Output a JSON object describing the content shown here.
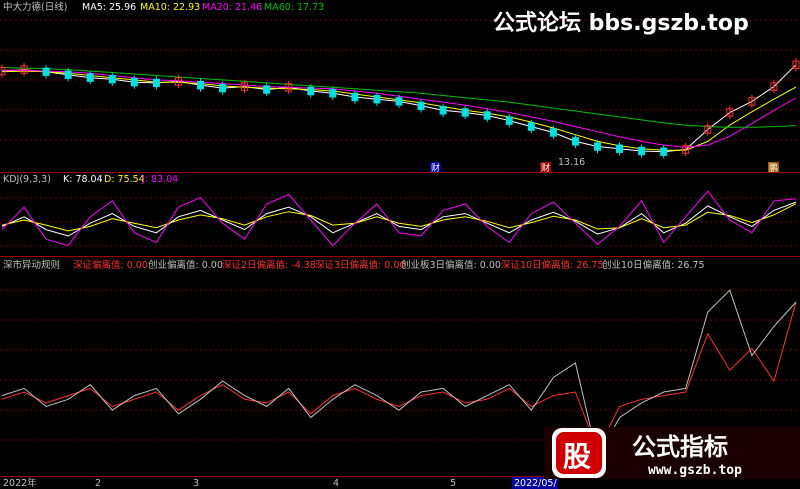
{
  "watermark_top": "公式论坛 bbs.gszb.top",
  "watermark_bottom": {
    "badge": "股",
    "title": "公式指标",
    "url": "www.gszb.top"
  },
  "panel1": {
    "stock": "中大力德(日线)",
    "ma": [
      {
        "label": "MA5: 25.96",
        "color": "#ffffff"
      },
      {
        "label": "MA10: 22.93",
        "color": "#ffff00"
      },
      {
        "label": "MA20: 21.46",
        "color": "#ff00ff"
      },
      {
        "label": "MA60: 17.73",
        "color": "#00c000"
      }
    ],
    "low_label": "13.16",
    "markers": [
      "财",
      "财",
      "鹏"
    ]
  },
  "panel2": {
    "title": "KDJ(9,3,3)",
    "k": "K: 78.04",
    "d": "D: 75.54",
    "j": "J: 83.04"
  },
  "panel3": {
    "title": "深市异动规则",
    "items": [
      {
        "label": "深证偏离值: 0.00",
        "color": "#ff3030"
      },
      {
        "label": "创业偏离值: 0.00",
        "color": "#c0c0c0"
      },
      {
        "label": "深证2日偏离值: -4.38",
        "color": "#ff3030"
      },
      {
        "label": "深证3日偏离值: 0.00",
        "color": "#ff3030"
      },
      {
        "label": "创业板3日偏离值: 0.00",
        "color": "#c0c0c0"
      },
      {
        "label": "深证10日偏离值: 26.75",
        "color": "#ff3030"
      },
      {
        "label": "创业10日偏离值: 26.75",
        "color": "#c0c0c0"
      }
    ]
  },
  "x_axis": [
    "2022年",
    "2",
    "3",
    "4",
    "5",
    "2022/05/"
  ],
  "colors": {
    "grid": "#7a0000",
    "up": "#ff3030",
    "down": "#00e0e0",
    "separator": "#a00000"
  },
  "chart_data": {
    "type": "line",
    "panels": [
      {
        "name": "price",
        "series": [
          {
            "name": "MA5",
            "values": [
              25.1,
              25.3,
              25.0,
              24.6,
              24.2,
              24.0,
              23.6,
              23.5,
              23.7,
              23.2,
              22.8,
              23.0,
              22.6,
              22.9,
              22.4,
              22.1,
              21.6,
              21.3,
              21.0,
              20.4,
              19.8,
              19.5,
              19.1,
              18.4,
              17.6,
              16.8,
              15.6,
              14.9,
              14.6,
              14.3,
              14.2,
              14.5,
              17.2,
              19.5,
              21.0,
              23.0,
              25.96
            ]
          },
          {
            "name": "MA10",
            "values": [
              25.0,
              25.1,
              25.0,
              24.8,
              24.5,
              24.2,
              23.9,
              23.6,
              23.6,
              23.4,
              23.1,
              22.9,
              22.8,
              22.7,
              22.6,
              22.4,
              22.0,
              21.6,
              21.2,
              20.8,
              20.3,
              19.8,
              19.4,
              18.9,
              18.2,
              17.4,
              16.5,
              15.6,
              15.0,
              14.6,
              14.4,
              14.4,
              15.6,
              17.8,
              19.6,
              21.3,
              22.93
            ]
          },
          {
            "name": "MA20",
            "values": [
              25.2,
              25.2,
              25.1,
              25.0,
              24.8,
              24.5,
              24.2,
              23.9,
              23.8,
              23.6,
              23.4,
              23.2,
              23.0,
              22.9,
              22.8,
              22.7,
              22.4,
              22.1,
              21.7,
              21.3,
              20.9,
              20.5,
              20.0,
              19.5,
              18.9,
              18.3,
              17.6,
              16.9,
              16.2,
              15.6,
              15.1,
              14.8,
              15.1,
              16.3,
              18.0,
              19.8,
              21.46
            ]
          },
          {
            "name": "MA60",
            "values": [
              25.6,
              25.5,
              25.4,
              25.3,
              25.1,
              24.9,
              24.7,
              24.5,
              24.3,
              24.1,
              23.9,
              23.7,
              23.5,
              23.3,
              23.1,
              22.9,
              22.7,
              22.5,
              22.3,
              22.1,
              21.8,
              21.5,
              21.2,
              20.9,
              20.5,
              20.1,
              19.7,
              19.3,
              18.9,
              18.5,
              18.1,
              17.8,
              17.6,
              17.5,
              17.5,
              17.6,
              17.73
            ]
          }
        ]
      },
      {
        "name": "KDJ",
        "series": [
          {
            "name": "K",
            "values": [
              40,
              55,
              35,
              25,
              45,
              60,
              40,
              30,
              55,
              65,
              50,
              35,
              60,
              70,
              55,
              30,
              45,
              60,
              40,
              35,
              55,
              60,
              45,
              30,
              50,
              62,
              48,
              28,
              38,
              60,
              30,
              45,
              72,
              55,
              40,
              65,
              78.04
            ]
          },
          {
            "name": "D",
            "values": [
              42,
              50,
              42,
              33,
              40,
              52,
              45,
              38,
              50,
              58,
              52,
              42,
              55,
              63,
              57,
              42,
              45,
              55,
              45,
              40,
              50,
              55,
              48,
              38,
              46,
              56,
              50,
              36,
              38,
              52,
              38,
              42,
              62,
              57,
              46,
              58,
              75.54
            ]
          },
          {
            "name": "J",
            "values": [
              35,
              70,
              20,
              10,
              55,
              80,
              30,
              15,
              70,
              85,
              45,
              20,
              75,
              90,
              50,
              10,
              45,
              75,
              30,
              25,
              65,
              75,
              40,
              15,
              60,
              78,
              45,
              12,
              40,
              80,
              15,
              55,
              95,
              50,
              30,
              80,
              83.04
            ]
          }
        ]
      },
      {
        "name": "深市异动规则",
        "series": [
          {
            "name": "深证10日偏离值",
            "values": [
              0,
              2,
              -1,
              1,
              3,
              -2,
              0,
              2,
              -3,
              1,
              4,
              0,
              -1,
              2,
              -4,
              1,
              3,
              0,
              -2,
              1,
              2,
              -1,
              0,
              3,
              -2,
              1,
              2,
              -14,
              -2,
              0,
              1,
              2,
              18,
              8,
              14,
              5,
              26.75
            ]
          },
          {
            "name": "创业10日偏离值",
            "values": [
              1,
              3,
              -2,
              0,
              4,
              -3,
              1,
              3,
              -4,
              0,
              5,
              1,
              -2,
              3,
              -5,
              0,
              4,
              1,
              -3,
              2,
              3,
              -2,
              1,
              4,
              -3,
              6,
              10,
              -16,
              -5,
              -1,
              2,
              3,
              24,
              30,
              12,
              20,
              26.75
            ]
          }
        ]
      }
    ]
  }
}
